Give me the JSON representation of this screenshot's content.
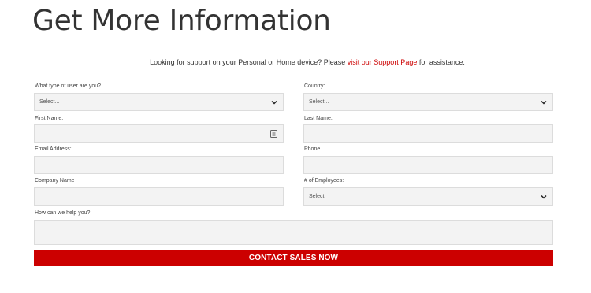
{
  "header": {
    "title": "Get More Information"
  },
  "support": {
    "text_before": "Looking for support on your Personal or Home device? Please ",
    "link_text": "visit our Support Page",
    "text_after": " for assistance."
  },
  "form": {
    "user_type": {
      "label": "What type of user are you?",
      "value": "Select..."
    },
    "country": {
      "label": "Country:",
      "value": "Select..."
    },
    "first_name": {
      "label": "First Name:",
      "value": ""
    },
    "last_name": {
      "label": "Last Name:",
      "value": ""
    },
    "email": {
      "label": "Email Address:",
      "value": ""
    },
    "phone": {
      "label": "Phone",
      "value": ""
    },
    "company": {
      "label": "Company Name",
      "value": ""
    },
    "employees": {
      "label": "# of Employees:",
      "value": "Select"
    },
    "help": {
      "label": "How can we help you?",
      "value": ""
    },
    "submit_label": "CONTACT SALES NOW"
  },
  "colors": {
    "accent": "#cc0000",
    "field_bg": "#f3f3f3",
    "field_border": "#dcdcdc"
  },
  "icons": {
    "dropdown": "chevron-down-icon",
    "autofill": "contact-card-icon"
  }
}
